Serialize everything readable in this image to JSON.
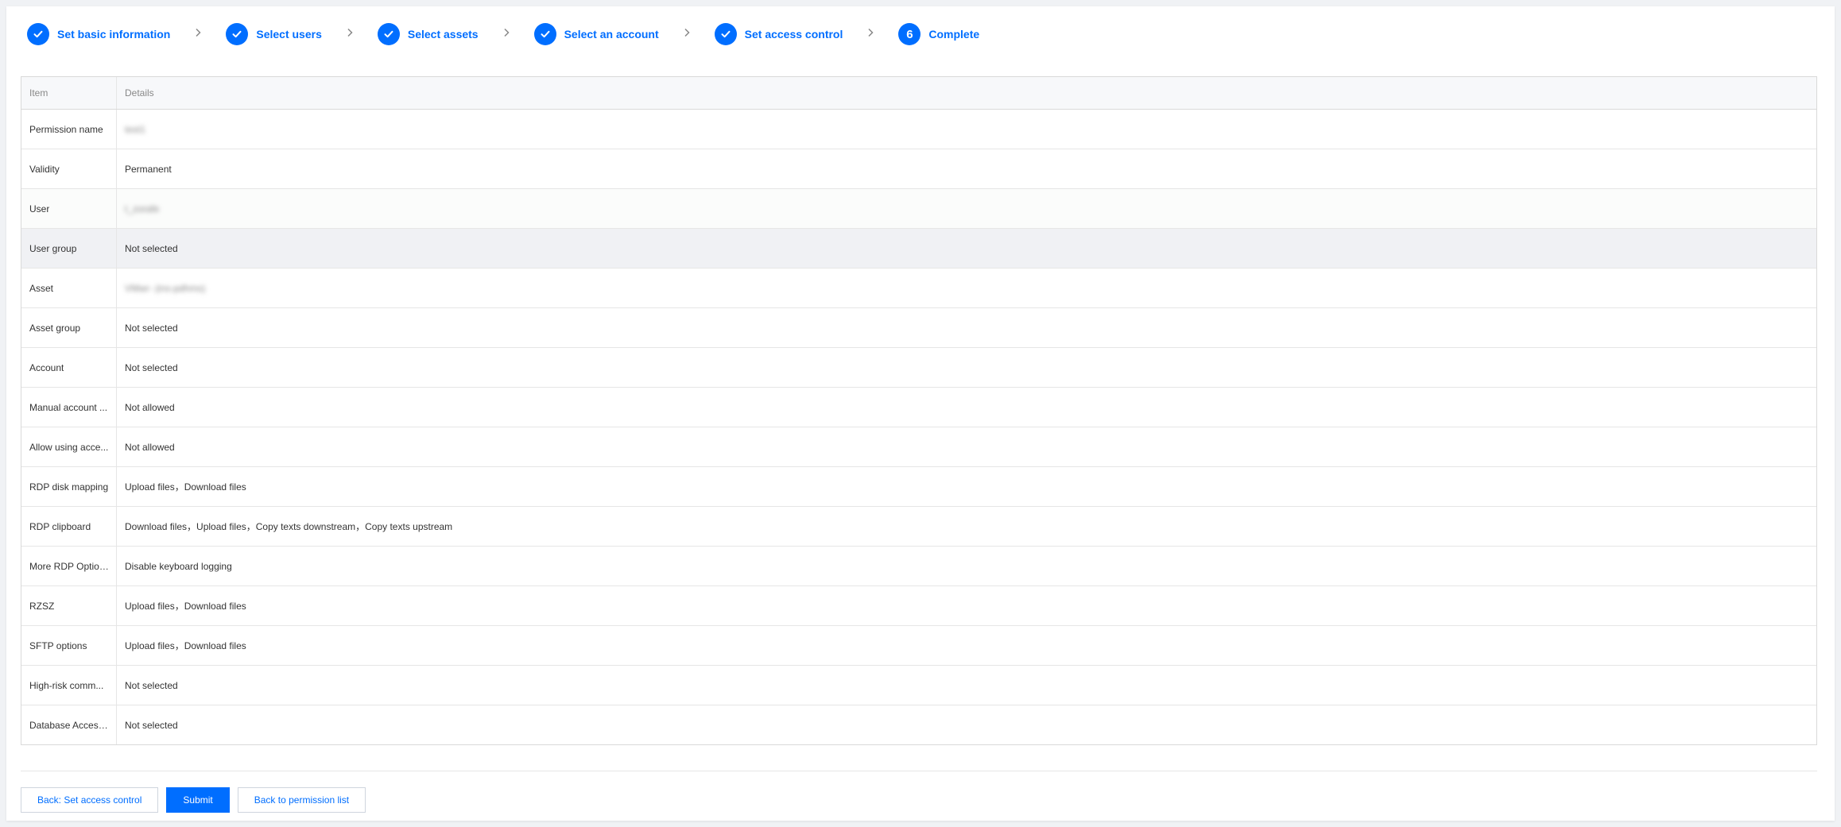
{
  "steps": [
    {
      "label": "Set basic information",
      "state": "done"
    },
    {
      "label": "Select users",
      "state": "done"
    },
    {
      "label": "Select assets",
      "state": "done"
    },
    {
      "label": "Select an account",
      "state": "done"
    },
    {
      "label": "Set access control",
      "state": "done"
    },
    {
      "label": "Complete",
      "state": "current",
      "number": "6"
    }
  ],
  "table": {
    "headers": {
      "item": "Item",
      "details": "Details"
    },
    "rows": [
      {
        "item": "Permission name",
        "details": "test1",
        "blurred": true
      },
      {
        "item": "Validity",
        "details": "Permanent"
      },
      {
        "item": "User",
        "details": "t_zorafe",
        "blurred": true
      },
      {
        "item": "User group",
        "details": "Not selected"
      },
      {
        "item": "Asset",
        "details": "VMwr- (ins-pdhms)",
        "blurred": true
      },
      {
        "item": "Asset group",
        "details": "Not selected"
      },
      {
        "item": "Account",
        "details": "Not selected"
      },
      {
        "item": "Manual account ...",
        "details": "Not allowed"
      },
      {
        "item": "Allow using acce...",
        "details": "Not allowed"
      },
      {
        "item": "RDP disk mapping",
        "details": "Upload files，Download files"
      },
      {
        "item": "RDP clipboard",
        "details": "Download files，Upload files，Copy texts downstream，Copy texts upstream"
      },
      {
        "item": "More RDP Options",
        "details": "Disable keyboard logging"
      },
      {
        "item": "RZSZ",
        "details": "Upload files，Download files"
      },
      {
        "item": "SFTP options",
        "details": "Upload files，Download files"
      },
      {
        "item": "High-risk comm...",
        "details": "Not selected"
      },
      {
        "item": "Database Access...",
        "details": "Not selected"
      }
    ]
  },
  "buttons": {
    "back": "Back: Set access control",
    "submit": "Submit",
    "back_list": "Back to permission list"
  },
  "colors": {
    "accent": "#006eff",
    "border": "#d9d9d9",
    "header_bg": "#f7f8fa"
  },
  "icons": {
    "step_done": "check-icon",
    "separator": "chevron-right-icon"
  }
}
